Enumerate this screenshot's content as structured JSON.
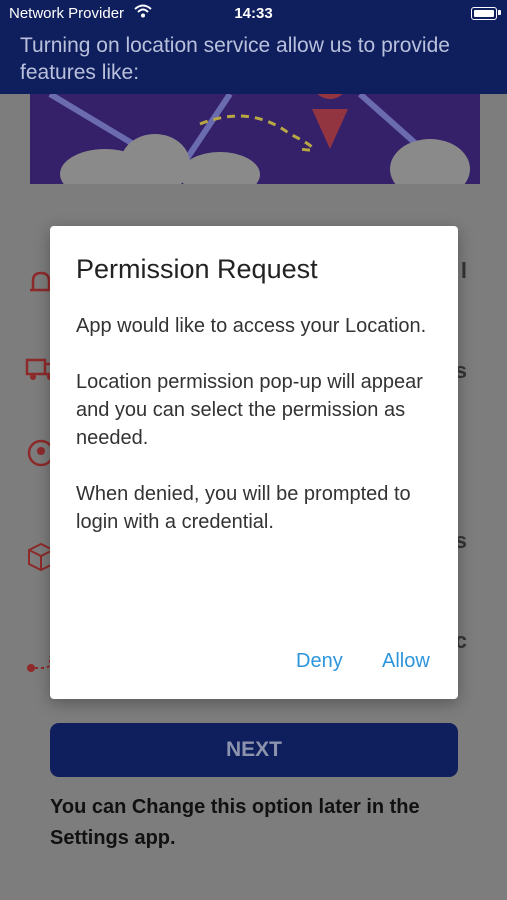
{
  "status_bar": {
    "carrier": "Network Provider",
    "time": "14:33"
  },
  "header": {
    "title": "Turning on location service allow us to provide features like:"
  },
  "dialog": {
    "title": "Permission Request",
    "paragraphs": [
      "App would like to access your Location.",
      "Location permission pop-up will appear and you can select the permission as needed.",
      "When denied, you will be prompted to login with a credential."
    ],
    "deny_label": "Deny",
    "allow_label": "Allow"
  },
  "next_label": "NEXT",
  "footnote": "You can Change this option later in the Settings app.",
  "feature_trails": [
    "l",
    "s",
    "s",
    "c"
  ],
  "colors": {
    "navy": "#0f1e5c",
    "dialog_button": "#2d95dc",
    "icon_red": "#b0222a"
  },
  "icons": [
    "bell-icon",
    "delivery-truck-icon",
    "location-target-icon",
    "package-icon",
    "route-icon"
  ]
}
